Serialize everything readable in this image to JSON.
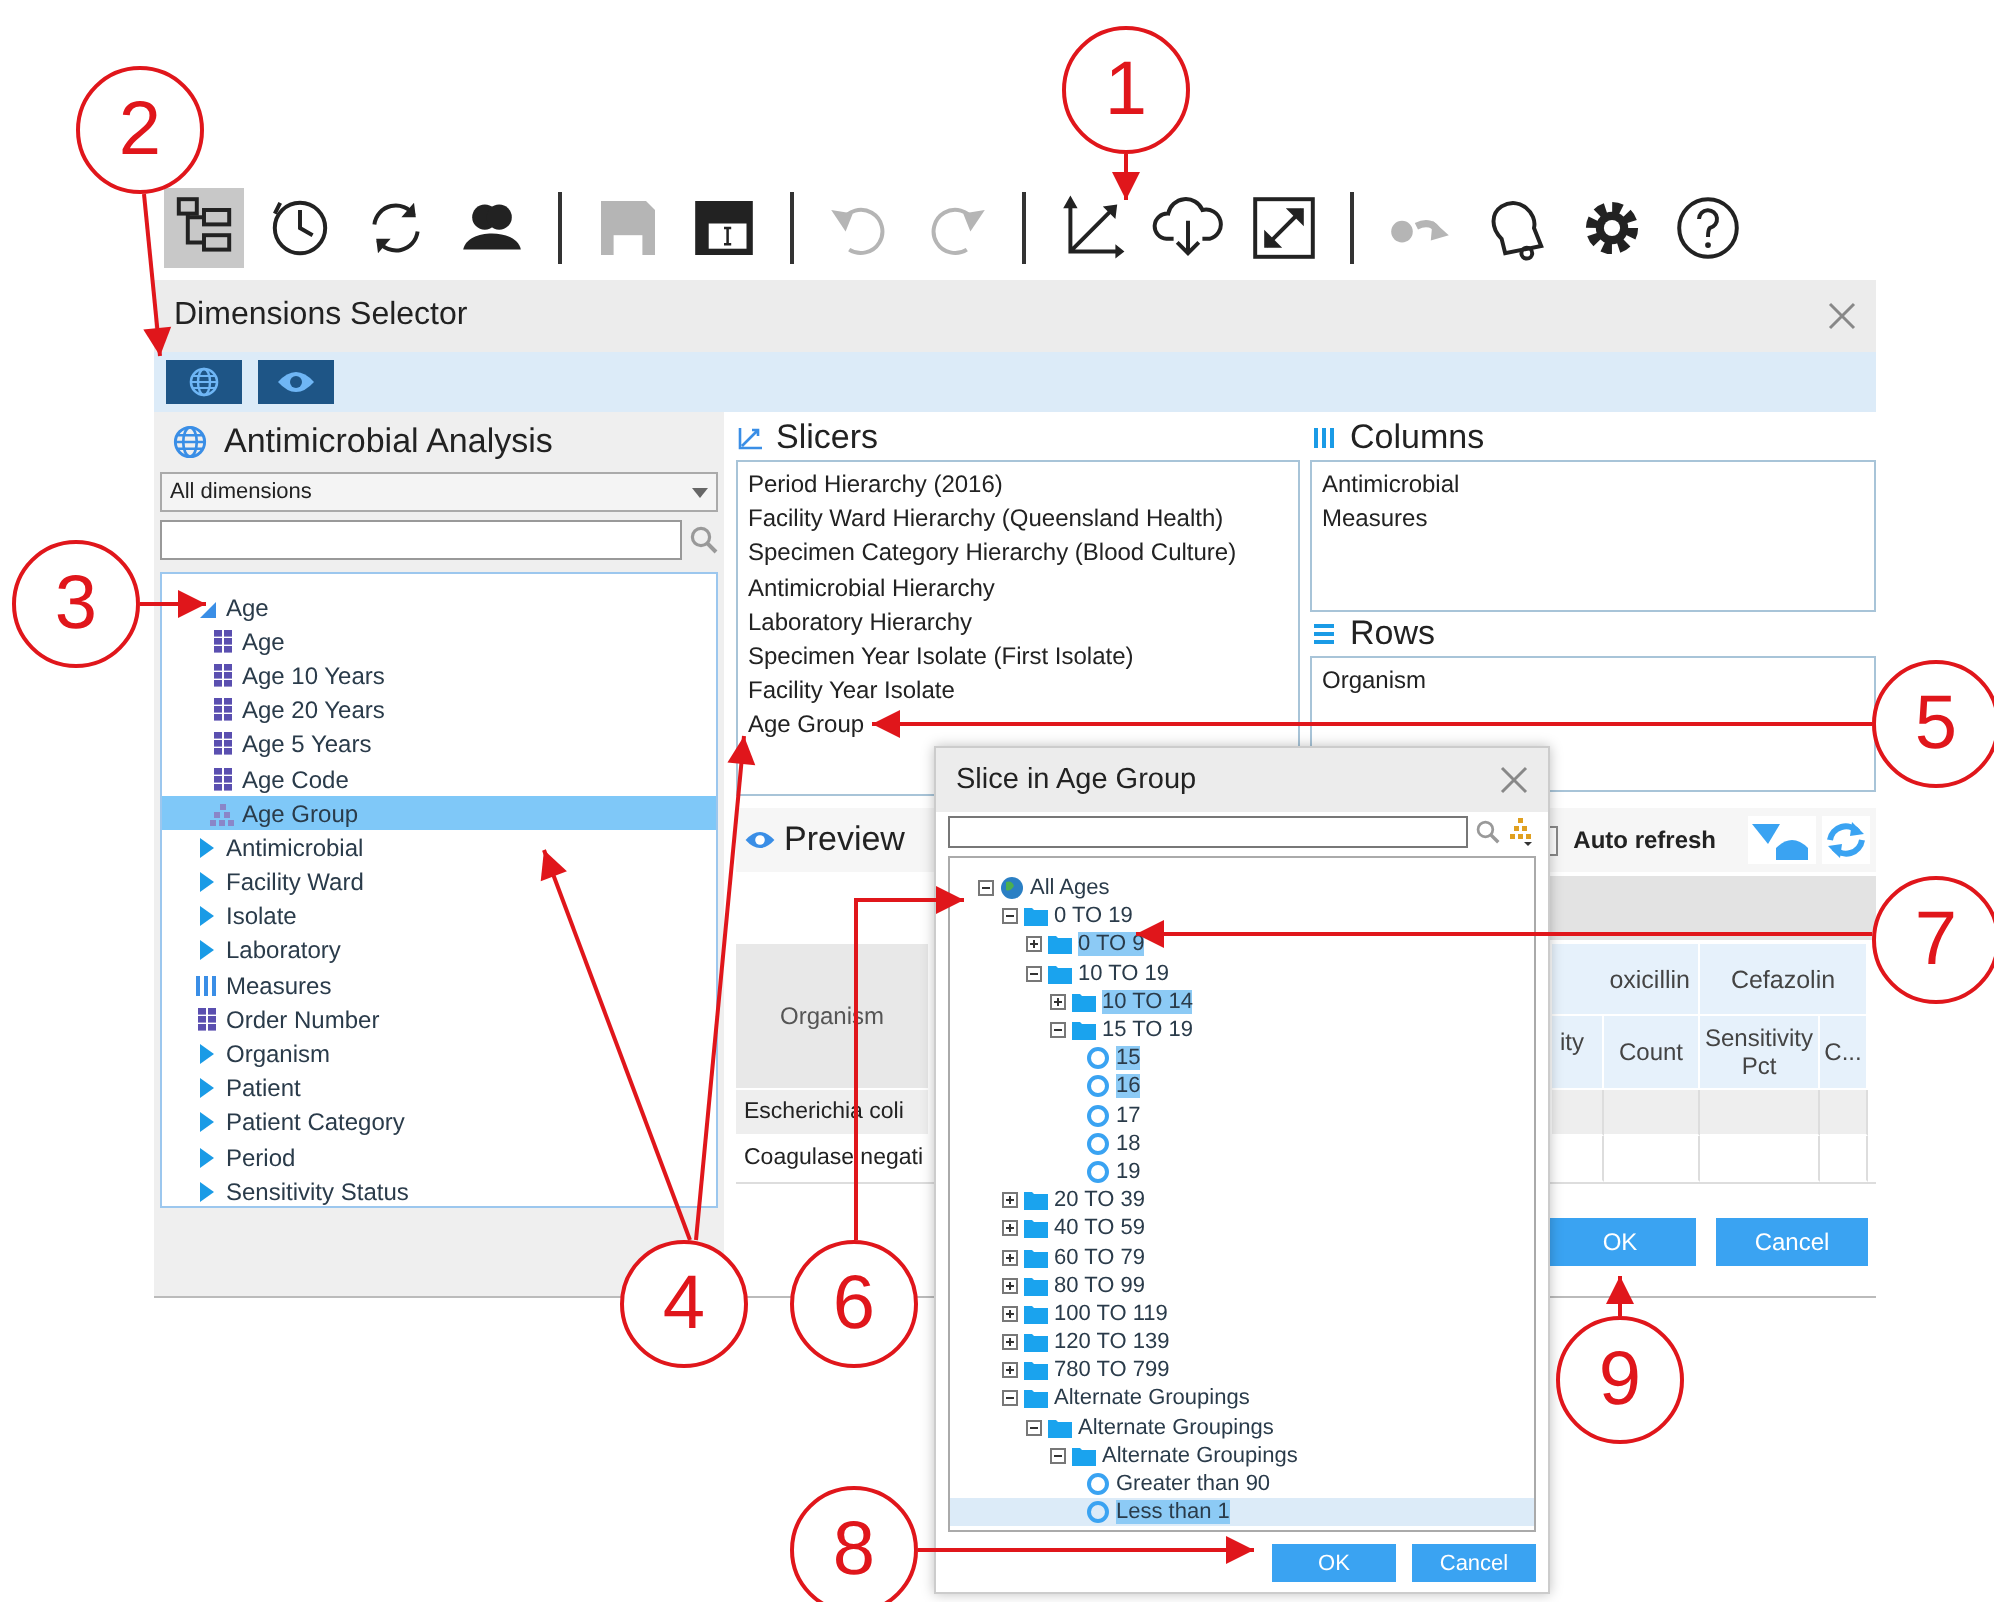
{
  "toolbar_groups": [
    {
      "items": [
        {
          "kind": "tree",
          "selected": true,
          "disabled": false
        },
        {
          "kind": "history",
          "selected": false,
          "disabled": false
        },
        {
          "kind": "refresh",
          "selected": false,
          "disabled": false
        },
        {
          "kind": "users",
          "selected": false,
          "disabled": false
        }
      ]
    },
    {
      "items": [
        {
          "kind": "save",
          "selected": false,
          "disabled": true
        },
        {
          "kind": "window",
          "selected": false,
          "disabled": false
        }
      ]
    },
    {
      "items": [
        {
          "kind": "undo",
          "selected": false,
          "disabled": true
        },
        {
          "kind": "redo",
          "selected": false,
          "disabled": true
        }
      ]
    },
    {
      "items": [
        {
          "kind": "axes",
          "selected": false,
          "disabled": false
        },
        {
          "kind": "cloud",
          "selected": false,
          "disabled": false
        },
        {
          "kind": "expand",
          "selected": false,
          "disabled": false
        }
      ]
    },
    {
      "items": [
        {
          "kind": "toggle",
          "selected": false,
          "disabled": true
        },
        {
          "kind": "bell",
          "selected": false,
          "disabled": false
        },
        {
          "kind": "gear",
          "selected": false,
          "disabled": false
        },
        {
          "kind": "help",
          "selected": false,
          "disabled": false
        }
      ]
    }
  ],
  "dialog": {
    "title": "Dimensions Selector",
    "view_buttons": [
      {
        "kind": "globe"
      },
      {
        "kind": "eye"
      }
    ],
    "cube": {
      "title": "Antimicrobial Analysis",
      "filter": "All dimensions",
      "tree": [
        {
          "label": "Age",
          "kind": "dimension",
          "expanded": true,
          "selected": false,
          "children": [
            {
              "label": "Age",
              "kind": "level",
              "selected": false
            },
            {
              "label": "Age 10 Years",
              "kind": "level",
              "selected": false
            },
            {
              "label": "Age 20 Years",
              "kind": "level",
              "selected": false
            },
            {
              "label": "Age 5 Years",
              "kind": "level",
              "selected": false
            },
            {
              "label": "Age Code",
              "kind": "level",
              "selected": false
            },
            {
              "label": "Age Group",
              "kind": "hierarchy",
              "selected": true
            }
          ]
        },
        {
          "label": "Antimicrobial",
          "kind": "dimension",
          "expanded": false,
          "selected": false
        },
        {
          "label": "Facility Ward",
          "kind": "dimension",
          "expanded": false,
          "selected": false
        },
        {
          "label": "Isolate",
          "kind": "dimension",
          "expanded": false,
          "selected": false
        },
        {
          "label": "Laboratory",
          "kind": "dimension",
          "expanded": false,
          "selected": false
        },
        {
          "label": "Measures",
          "kind": "measures",
          "selected": false
        },
        {
          "label": "Order Number",
          "kind": "level",
          "selected": false
        },
        {
          "label": "Organism",
          "kind": "dimension",
          "expanded": false,
          "selected": false
        },
        {
          "label": "Patient",
          "kind": "dimension",
          "expanded": false,
          "selected": false
        },
        {
          "label": "Patient Category",
          "kind": "dimension",
          "expanded": false,
          "selected": false
        },
        {
          "label": "Period",
          "kind": "dimension",
          "expanded": false,
          "selected": false
        },
        {
          "label": "Sensitivity Status",
          "kind": "dimension",
          "expanded": false,
          "selected": false
        }
      ]
    },
    "slicers": {
      "title": "Slicers",
      "items": [
        "Period Hierarchy (2016)",
        "Facility Ward Hierarchy (Queensland Health)",
        "Specimen Category Hierarchy (Blood Culture)",
        "Antimicrobial Hierarchy",
        "Laboratory Hierarchy",
        "Specimen Year Isolate (First Isolate)",
        "Facility Year Isolate",
        "Age Group"
      ]
    },
    "columns": {
      "title": "Columns",
      "items": [
        "Antimicrobial",
        "Measures"
      ]
    },
    "rows": {
      "title": "Rows",
      "items": [
        "Organism"
      ]
    },
    "preview": {
      "title": "Preview",
      "auto_refresh": {
        "label": "Auto refresh",
        "checked": false
      },
      "table": {
        "row_header": "Organism",
        "group_headers": [
          "oxicillin",
          "Cefazolin"
        ],
        "sub_headers": [
          "ity",
          "Count",
          "Sensitivity Pct",
          "C..."
        ],
        "rows": [
          "Escherichia coli",
          "Coagulase negati"
        ]
      }
    },
    "buttons": [
      "OK",
      "Cancel"
    ]
  },
  "slice_dialog": {
    "title": "Slice in Age Group",
    "tree": [
      {
        "label": "All Ages",
        "kind": "root",
        "expanded": true,
        "selected": false,
        "children": [
          {
            "label": "0 TO 19",
            "kind": "folder",
            "expanded": true,
            "selected": false,
            "children": [
              {
                "label": "0 TO 9",
                "kind": "folder",
                "expanded": false,
                "selected": true
              },
              {
                "label": "10 TO 19",
                "kind": "folder",
                "expanded": true,
                "selected": false,
                "children": [
                  {
                    "label": "10 TO 14",
                    "kind": "folder",
                    "expanded": false,
                    "selected": true
                  },
                  {
                    "label": "15 TO 19",
                    "kind": "folder",
                    "expanded": true,
                    "selected": false,
                    "children": [
                      {
                        "label": "15",
                        "kind": "member",
                        "selected": true
                      },
                      {
                        "label": "16",
                        "kind": "member",
                        "selected": true
                      },
                      {
                        "label": "17",
                        "kind": "member",
                        "selected": false
                      },
                      {
                        "label": "18",
                        "kind": "member",
                        "selected": false
                      },
                      {
                        "label": "19",
                        "kind": "member",
                        "selected": false
                      }
                    ]
                  }
                ]
              }
            ]
          },
          {
            "label": "20 TO 39",
            "kind": "folder",
            "expanded": false,
            "selected": false
          },
          {
            "label": "40 TO 59",
            "kind": "folder",
            "expanded": false,
            "selected": false
          },
          {
            "label": "60 TO 79",
            "kind": "folder",
            "expanded": false,
            "selected": false
          },
          {
            "label": "80 TO 99",
            "kind": "folder",
            "expanded": false,
            "selected": false
          },
          {
            "label": "100 TO 119",
            "kind": "folder",
            "expanded": false,
            "selected": false
          },
          {
            "label": "120 TO 139",
            "kind": "folder",
            "expanded": false,
            "selected": false
          },
          {
            "label": "780 TO 799",
            "kind": "folder",
            "expanded": false,
            "selected": false
          },
          {
            "label": "Alternate Groupings",
            "kind": "folder",
            "expanded": true,
            "selected": false,
            "children": [
              {
                "label": "Alternate Groupings",
                "kind": "folder",
                "expanded": true,
                "selected": false,
                "children": [
                  {
                    "label": "Alternate Groupings",
                    "kind": "folder",
                    "expanded": true,
                    "selected": false,
                    "children": [
                      {
                        "label": "Greater than 90",
                        "kind": "member",
                        "selected": false
                      },
                      {
                        "label": "Less than 1",
                        "kind": "member",
                        "selected": true,
                        "focused": true
                      }
                    ]
                  }
                ]
              }
            ]
          }
        ]
      }
    ],
    "buttons": [
      "OK",
      "Cancel"
    ]
  },
  "callouts": [
    {
      "number": "1"
    },
    {
      "number": "2"
    },
    {
      "number": "3"
    },
    {
      "number": "4"
    },
    {
      "number": "5"
    },
    {
      "number": "6"
    },
    {
      "number": "7"
    },
    {
      "number": "8"
    },
    {
      "number": "9"
    }
  ]
}
